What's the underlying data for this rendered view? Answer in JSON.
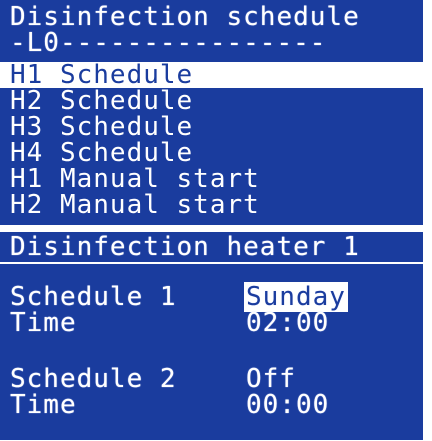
{
  "menu_panel": {
    "title": "Disinfection schedule",
    "separator": "-L0----------------",
    "items": [
      {
        "label": "H1 Schedule",
        "selected": true
      },
      {
        "label": "H2 Schedule",
        "selected": false
      },
      {
        "label": "H3 Schedule",
        "selected": false
      },
      {
        "label": "H4 Schedule",
        "selected": false
      },
      {
        "label": "H1 Manual start",
        "selected": false
      },
      {
        "label": "H2 Manual start",
        "selected": false
      }
    ]
  },
  "detail_panel": {
    "title": "Disinfection heater 1",
    "schedule1": {
      "label": "Schedule 1",
      "day": "Sunday",
      "time_label": "Time",
      "time": "02:00"
    },
    "schedule2": {
      "label": "Schedule 2",
      "day": "Off",
      "time_label": "Time",
      "time": "00:00"
    }
  },
  "colors": {
    "lcd_background": "#1a3c9e",
    "lcd_text": "#ffffff"
  }
}
